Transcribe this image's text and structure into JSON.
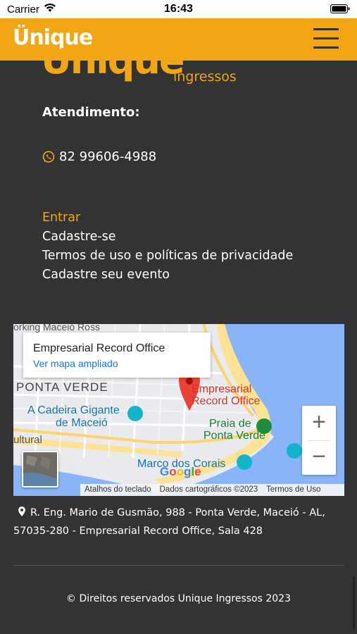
{
  "status_bar": {
    "carrier": "Carrier",
    "time": "16:43"
  },
  "header": {
    "logo": "Ünique",
    "menu_icon": "hamburger-icon"
  },
  "footer_logo": {
    "word": "Ünique",
    "sub": "ingressos"
  },
  "contact": {
    "title": "Atendimento:",
    "phone": "82 99606-4988",
    "phone_icon": "whatsapp-icon"
  },
  "links": [
    {
      "label": "Entrar"
    },
    {
      "label": "Cadastre-se"
    },
    {
      "label": "Termos de uso e políticas de privacidade"
    },
    {
      "label": "Cadastre seu evento"
    }
  ],
  "map": {
    "card_title": "Empresarial Record Office",
    "card_link": "Ver mapa ampliado",
    "labels": {
      "top": "orking Maceió Ross",
      "ponta_verde": "PONTA VERDE",
      "empresarial": "Empresarial",
      "record_office": "Record Office",
      "cadeira": "A Cadeira Gigante",
      "maceio": "de Maceió",
      "praia": "Praia de",
      "ponta_verde2": "Ponta Verde",
      "cultural": "ultural",
      "marco": "Marco dos Corais",
      "google": "Google"
    },
    "zoom_in": "+",
    "zoom_out": "−",
    "footer": [
      "Atalhos do teclado",
      "Dados cartográficos ©2023",
      "Termos de Uso"
    ]
  },
  "address": "R. Eng. Mario de Gusmão, 988 - Ponta Verde, Maceió - AL, 57035-280 - Empresarial Record Office, Sala 428",
  "copyright": "© Direitos reservados Unique Ingressos 2023",
  "colors": {
    "accent": "#f2a614",
    "background": "#333333"
  }
}
